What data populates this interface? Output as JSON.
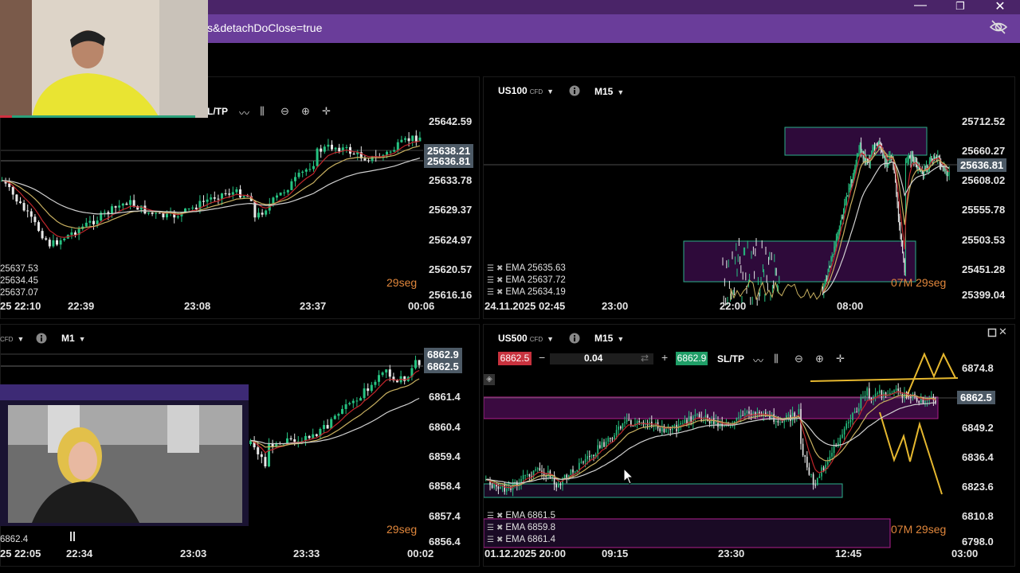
{
  "browser": {
    "url": "s&detachDoClose=true",
    "minimize": "—",
    "maximize": "❐",
    "close": "✕"
  },
  "top_left": {
    "sltp": "L/TP",
    "y_ticks": [
      "25642.59",
      "25633.78",
      "25629.37",
      "25624.97",
      "25620.57",
      "25616.16"
    ],
    "price_tags": [
      "25638.21",
      "25636.81"
    ],
    "x_ticks": [
      "25 22:10",
      "22:39",
      "23:08",
      "23:37",
      "00:06"
    ],
    "ohlc": [
      "25637.53",
      "25634.45",
      "25637.07"
    ],
    "timer": "29seg"
  },
  "top_right": {
    "symbol": "US100",
    "cfd": "CFD",
    "timeframe": "M15",
    "y_ticks": [
      "25712.52",
      "25660.27",
      "25608.02",
      "25555.78",
      "25503.53",
      "25451.28",
      "25399.04"
    ],
    "price_tag": "25636.81",
    "x_ticks": [
      "24.11.2025 02:45",
      "23:00",
      "22:00",
      "08:00"
    ],
    "emas": [
      "EMA 25635.63",
      "EMA 25637.72",
      "EMA 25634.19"
    ],
    "timer": "07M 29seg"
  },
  "bottom_left": {
    "symbol_suffix": "CFD",
    "timeframe": "M1",
    "y_ticks": [
      "6861.4",
      "6860.4",
      "6859.4",
      "6858.4",
      "6857.4",
      "6856.4"
    ],
    "price_tags": [
      "6862.9",
      "6862.5"
    ],
    "x_ticks": [
      "25 22:05",
      "22:34",
      "23:03",
      "23:33",
      "00:02"
    ],
    "ohlc": "6862.4",
    "timer": "29seg"
  },
  "bottom_right": {
    "symbol": "US500",
    "cfd": "CFD",
    "timeframe": "M15",
    "bid": "6862.5",
    "ask": "6862.9",
    "lot": "0.04",
    "minus": "−",
    "plus": "+",
    "sltp": "SL/TP",
    "y_ticks": [
      "6874.8",
      "6849.2",
      "6836.4",
      "6823.6",
      "6810.8",
      "6798.0"
    ],
    "price_tag": "6862.5",
    "x_ticks": [
      "01.12.2025 20:00",
      "09:15",
      "23:30",
      "12:45",
      "03:00"
    ],
    "emas": [
      "EMA 6861.5",
      "EMA 6859.8",
      "EMA 6861.4"
    ],
    "timer": "07M 29seg"
  },
  "colors": {
    "up_candle": "#26c281",
    "down_candle": "#e8e8e8",
    "zone": "#2e0a3a",
    "zone_border": "#2bb08a",
    "ema_red": "#c0262b",
    "ema_yellow": "#c8b060",
    "ema_white": "#d0d0d0",
    "timer": "#e0863b",
    "title_bar": "#4a2468",
    "address_bar": "#6a3d9a"
  }
}
